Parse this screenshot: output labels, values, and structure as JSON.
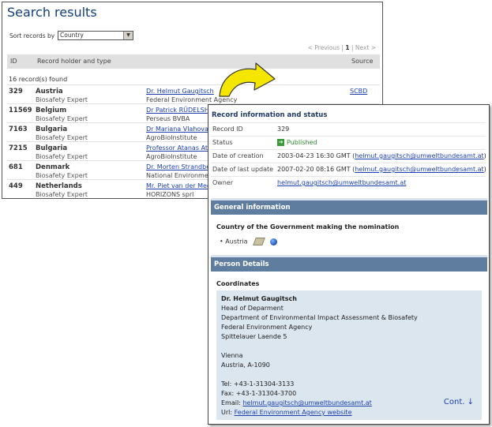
{
  "search": {
    "title": "Search results",
    "sort_label": "Sort records by",
    "sort_value": "Country",
    "pager_prev": "< Previous",
    "pager_sep": "|",
    "pager_current": "1",
    "pager_next": "Next >",
    "col_id": "ID",
    "col_holder": "Record holder and type",
    "col_source": "Source",
    "count_text": "16 record(s) found",
    "rows": [
      {
        "id": "329",
        "country": "Austria",
        "type": "Biosafety Expert",
        "name": "Dr. Helmut  Gaugitsch",
        "org": "Federal Environment Agency",
        "source": "SCBD"
      },
      {
        "id": "11569",
        "country": "Belgium",
        "type": "Biosafety Expert",
        "name": "Dr Patrick RÜDELSH",
        "org": "Perseus BVBA",
        "source": ""
      },
      {
        "id": "7163",
        "country": "Bulgaria",
        "type": "Biosafety Expert",
        "name": "Dr Mariana Vlahova",
        "org": "AgroBioInstitute",
        "source": ""
      },
      {
        "id": "7215",
        "country": "Bulgaria",
        "type": "Biosafety Expert",
        "name": "Professor Atanas Ata",
        "org": "AgroBioInstitute",
        "source": ""
      },
      {
        "id": "681",
        "country": "Denmark",
        "type": "Biosafety Expert",
        "name": "Dr. Morten Strandbe",
        "org": "National Environme",
        "source": ""
      },
      {
        "id": "449",
        "country": "Netherlands",
        "type": "Biosafety Expert",
        "name": "Mr. Piet  van der Mee",
        "org": "HORIZONS sprl",
        "source": ""
      }
    ]
  },
  "detail": {
    "header": "Record information and status",
    "record_id_label": "Record ID",
    "record_id_value": "329",
    "status_label": "Status",
    "status_value": "Published",
    "creation_label": "Date of creation",
    "creation_value": "2003-04-23 16:30 GMT (",
    "creation_email": "helmut.gaugitsch@umweltbundesamt.at",
    "creation_close": ")",
    "update_label": "Date of last update",
    "update_value": "2007-02-20 08:16 GMT (",
    "update_email": "helmut.gaugitsch@umweltbundesamt.at",
    "update_close": ")",
    "owner_label": "Owner",
    "owner_email": "helmut.gaugitsch@umweltbundesamt.at",
    "general_bar": "General information",
    "gov_title": "Country of the Government making the nomination",
    "gov_country": "Austria",
    "person_bar": "Person Details",
    "coord_title": "Coordinates",
    "coord_name": "Dr. Helmut  Gaugitsch",
    "coord_lines": [
      "Head of Deparment",
      "Department of Environmental Impact Assessment & Biosafety",
      "Federal Environment Agency",
      "Spittelauer Laende 5",
      "",
      "Vienna",
      "Austria, A-1090",
      "",
      "Tel: +43-1-31304-3133",
      "Fax: +43-1-31304-3700"
    ],
    "email_label": "Email: ",
    "email_value": "helmut.gaugitsch@umweltbundesamt.at",
    "url_label": "Url: ",
    "url_value": "Federal Environment Agency website",
    "cont_label": "Cont. ↓"
  },
  "colors": {
    "title_blue": "#123e7a",
    "link_blue": "#1c3fb0",
    "section_bar": "#5f7e9f",
    "coord_bg": "#dbe6ee",
    "arrow_yellow": "#f5e600"
  }
}
